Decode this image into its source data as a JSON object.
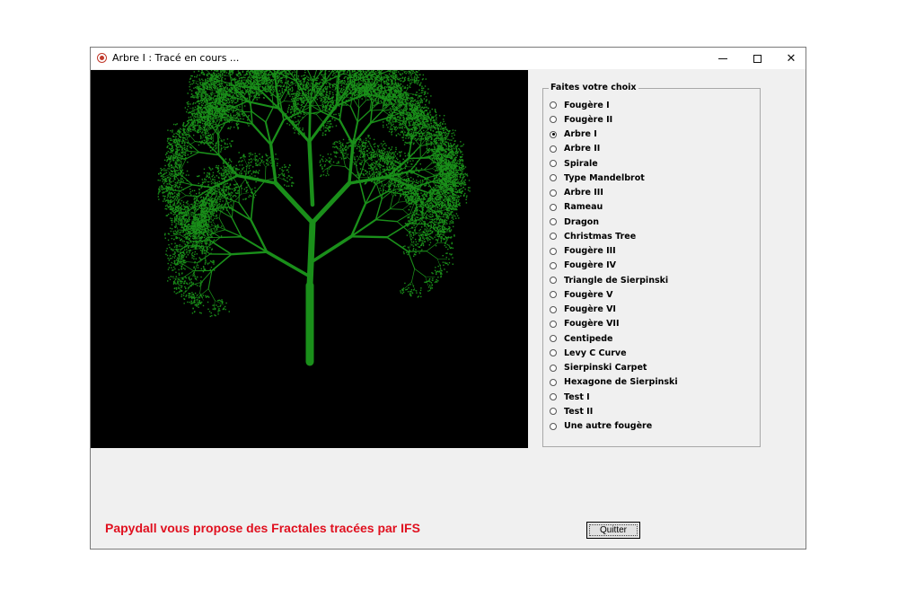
{
  "window": {
    "title": "Arbre I : Tracé en cours ...",
    "controls": {
      "minimize": "min",
      "maximize": "max",
      "close": "✕"
    }
  },
  "canvas": {
    "background": "#000000",
    "fractal_color": "#1a8f1a",
    "fractal": "Arbre I"
  },
  "choices": {
    "legend": "Faites votre choix",
    "items": [
      {
        "label": "Fougère I",
        "checked": false
      },
      {
        "label": "Fougère II",
        "checked": false
      },
      {
        "label": "Arbre I",
        "checked": true
      },
      {
        "label": "Arbre II",
        "checked": false
      },
      {
        "label": "Spirale",
        "checked": false
      },
      {
        "label": "Type Mandelbrot",
        "checked": false
      },
      {
        "label": "Arbre III",
        "checked": false
      },
      {
        "label": "Rameau",
        "checked": false
      },
      {
        "label": "Dragon",
        "checked": false
      },
      {
        "label": "Christmas Tree",
        "checked": false
      },
      {
        "label": "Fougère III",
        "checked": false
      },
      {
        "label": "Fougère IV",
        "checked": false
      },
      {
        "label": "Triangle de Sierpinski",
        "checked": false
      },
      {
        "label": "Fougère V",
        "checked": false
      },
      {
        "label": "Fougère VI",
        "checked": false
      },
      {
        "label": "Fougère VII",
        "checked": false
      },
      {
        "label": "Centipede",
        "checked": false
      },
      {
        "label": "Levy C Curve",
        "checked": false
      },
      {
        "label": "Sierpinski Carpet",
        "checked": false
      },
      {
        "label": "Hexagone de Sierpinski",
        "checked": false
      },
      {
        "label": "Test I",
        "checked": false
      },
      {
        "label": "Test II",
        "checked": false
      },
      {
        "label": "Une autre fougère",
        "checked": false
      }
    ]
  },
  "footer": {
    "message": "Papydall vous propose des Fractales tracées par IFS",
    "message_color": "#e0101f",
    "quit_label": "Quitter"
  }
}
